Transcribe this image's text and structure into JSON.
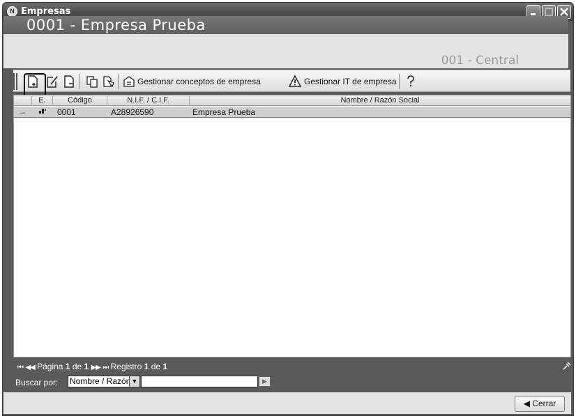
{
  "window": {
    "title": "Empresas",
    "app_icon_letter": "N"
  },
  "header": {
    "company_title": "0001 - Empresa Prueba",
    "center_name": "001 - Central"
  },
  "toolbar": {
    "buttons": [
      {
        "icon": "new-document-icon"
      },
      {
        "icon": "edit-document-icon"
      },
      {
        "icon": "delete-document-icon"
      },
      {
        "icon": "copy-icon"
      },
      {
        "icon": "paste-document-icon"
      }
    ],
    "manage_concepts_label": "Gestionar conceptos de empresa",
    "manage_it_label": "Gestionar IT de empresa",
    "help_icon": "help-icon"
  },
  "grid": {
    "columns": [
      "E.",
      "Código",
      "N.I.F. / C.I.F.",
      "Nombre / Razón Social"
    ],
    "rows": [
      {
        "indicator": "→",
        "codigo": "0001",
        "nif": "A28926590",
        "nombre": "Empresa Prueba"
      }
    ]
  },
  "status": {
    "page_label": "Página",
    "page_current": "1",
    "of_label": "de",
    "page_total": "1",
    "record_label": "Registro",
    "record_current": "1",
    "record_total": "1",
    "search_label": "Buscar por:",
    "search_field": "Nombre / Razón Social",
    "search_value": ""
  },
  "footer": {
    "close_label": "Cerrar"
  }
}
